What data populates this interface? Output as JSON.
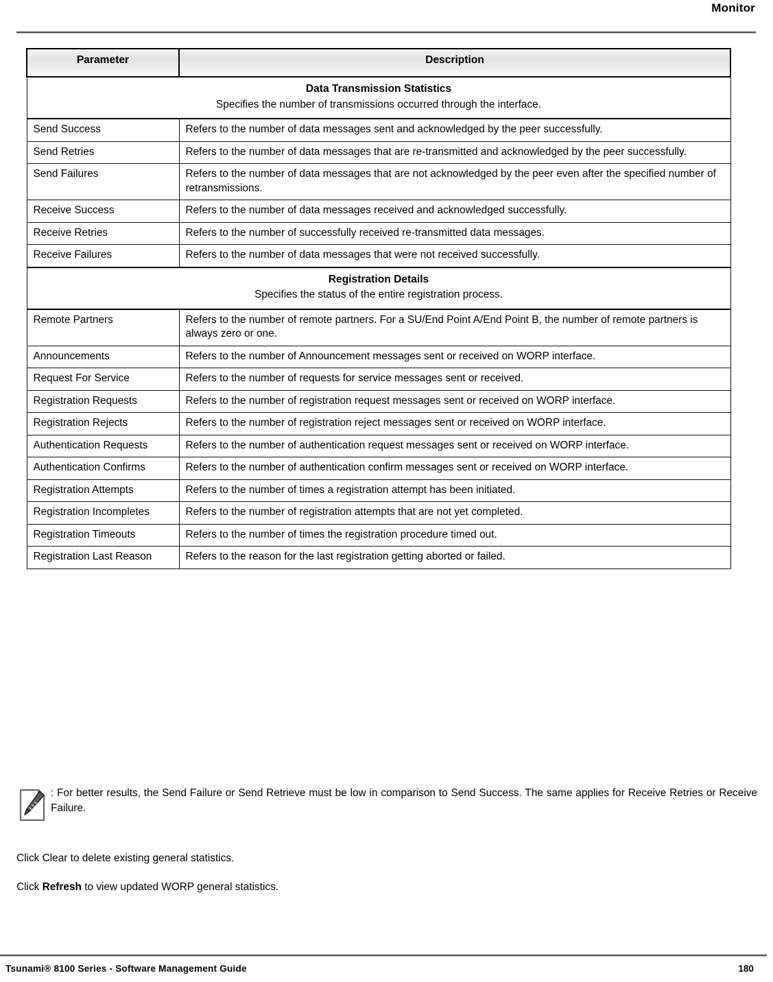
{
  "page": {
    "header_title": "Monitor",
    "footer_left": "Tsunami® 8100 Series - Software Management Guide",
    "footer_page_number": "180"
  },
  "table": {
    "columns": {
      "parameter": "Parameter",
      "description": "Description"
    },
    "sections": [
      {
        "title": "Data Transmission Statistics",
        "subtitle": "Specifies the number of transmissions occurred through the interface.",
        "rows": [
          {
            "parameter": "Send Success",
            "description": "Refers to the number of data messages sent and acknowledged by the peer successfully."
          },
          {
            "parameter": "Send Retries",
            "description": "Refers to the number of data messages that are re-transmitted and acknowledged by the peer successfully."
          },
          {
            "parameter": "Send Failures",
            "description": "Refers to the number of data messages that are not acknowledged by the peer even after the specified number of retransmissions."
          },
          {
            "parameter": "Receive Success",
            "description": "Refers to the number of data messages received and acknowledged successfully."
          },
          {
            "parameter": "Receive Retries",
            "description": "Refers to the number of successfully received re-transmitted data messages."
          },
          {
            "parameter": "Receive Failures",
            "description": "Refers to the number of data messages that were not received successfully."
          }
        ]
      },
      {
        "title": "Registration Details",
        "subtitle": "Specifies the status of the entire registration process.",
        "rows": [
          {
            "parameter": "Remote Partners",
            "description": "Refers to the number of remote partners. For a SU/End Point A/End Point B, the number of remote partners is always zero or one."
          },
          {
            "parameter": "Announcements",
            "description": "Refers to the number of Announcement messages sent or received on WORP interface."
          },
          {
            "parameter": "Request For Service",
            "description": "Refers to the number of requests for service messages sent or received."
          },
          {
            "parameter": "Registration Requests",
            "description": "Refers to the number of registration request messages sent or received on WORP interface."
          },
          {
            "parameter": "Registration Rejects",
            "description": "Refers to the number of registration reject messages sent or received on WORP interface."
          },
          {
            "parameter": "Authentication Requests",
            "description": "Refers to the number of authentication request messages sent or received on WORP interface."
          },
          {
            "parameter": "Authentication Confirms",
            "description": "Refers to the number of authentication confirm messages sent or received on WORP interface."
          },
          {
            "parameter": "Registration Attempts",
            "description": "Refers to the number of times a registration attempt has been initiated."
          },
          {
            "parameter": "Registration Incompletes",
            "description": "Refers to the number of registration attempts that are not yet completed."
          },
          {
            "parameter": "Registration Timeouts",
            "description": "Refers to the number of times the registration procedure timed out."
          },
          {
            "parameter": "Registration Last Reason",
            "description": "Refers to the reason for the last registration getting aborted or failed."
          }
        ]
      }
    ]
  },
  "note": {
    "icon": "note-pencil-icon",
    "text": ": For better results, the Send Failure or Send Retrieve must be low in comparison to Send Success. The same applies for Receive Retries or Receive Failure."
  },
  "paragraphs": {
    "clear": {
      "prefix": "Click Clear to delete existing general statistics."
    },
    "refresh": {
      "prefix": "Click ",
      "bold": "Refresh",
      "suffix": " to view updated WORP general statistics."
    }
  }
}
